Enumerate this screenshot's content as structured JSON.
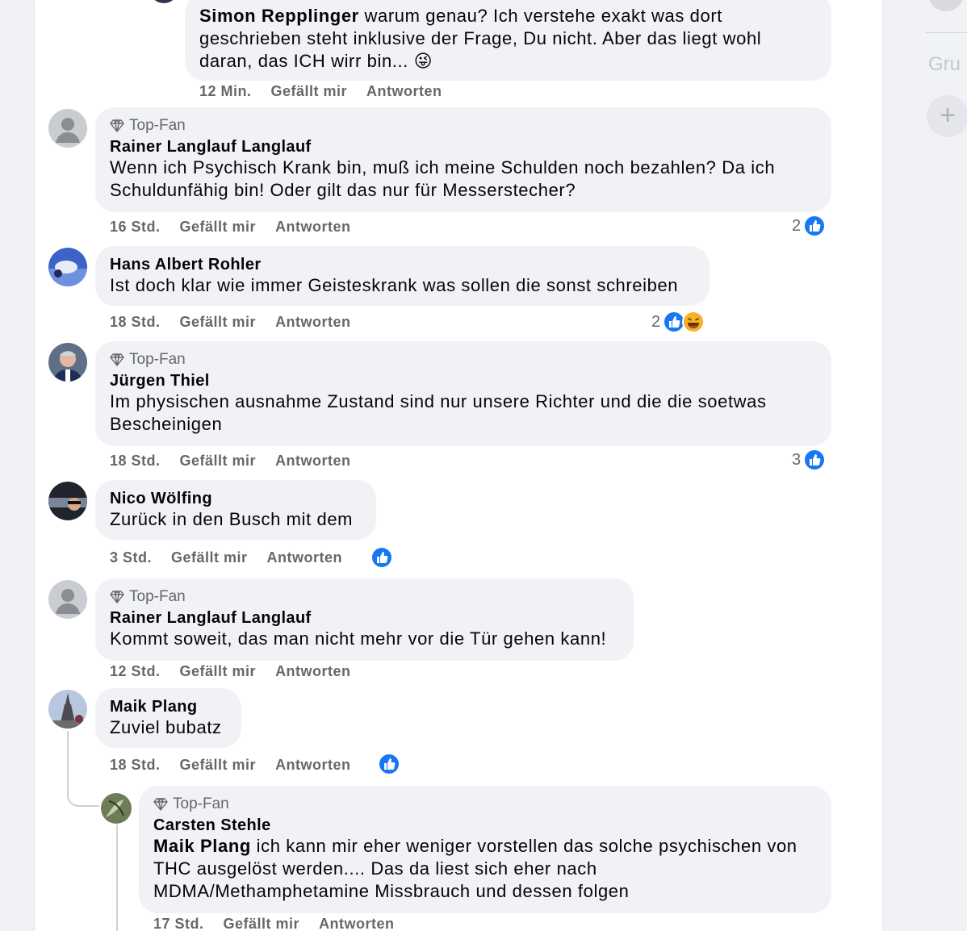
{
  "colors": {
    "like_blue": "#1877f2",
    "bubble_bg": "#f0f2f5",
    "meta_text": "#65676b"
  },
  "sidebar": {
    "group_label_fragment": "Gru",
    "add_label": "+"
  },
  "comments": [
    {
      "author": "Simon Repplinger",
      "text": " warum genau? Ich verstehe exakt was dort geschrieben steht inklusive der Frage, Du nicht. Aber das liegt wohl daran, das ICH wirr bin... 😜",
      "time": "12 Min.",
      "like_label": "Gefällt mir",
      "reply_label": "Antworten"
    },
    {
      "badge": "Top-Fan",
      "author": "Rainer Langlauf Langlauf",
      "text": "Wenn ich Psychisch Krank bin, muß ich meine Schulden noch bezahlen? Da ich Schuldunfähig bin! Oder gilt das nur für Messerstecher?",
      "time": "16 Std.",
      "like_label": "Gefällt mir",
      "reply_label": "Antworten",
      "reaction_count": "2",
      "reactions": [
        "like"
      ]
    },
    {
      "author": "Hans Albert Rohler",
      "text": "Ist doch klar wie immer Geisteskrank was sollen die sonst schreiben",
      "time": "18 Std.",
      "like_label": "Gefällt mir",
      "reply_label": "Antworten",
      "reaction_count": "2",
      "reactions": [
        "like",
        "haha"
      ]
    },
    {
      "badge": "Top-Fan",
      "author": "Jürgen Thiel",
      "text": "Im physischen ausnahme Zustand sind nur unsere Richter und die die soetwas Bescheinigen",
      "time": "18 Std.",
      "like_label": "Gefällt mir",
      "reply_label": "Antworten",
      "reaction_count": "3",
      "reactions": [
        "like"
      ]
    },
    {
      "author": "Nico Wölfing",
      "text": "Zurück in den Busch mit dem",
      "time": "3 Std.",
      "like_label": "Gefällt mir",
      "reply_label": "Antworten",
      "reactions": [
        "like"
      ]
    },
    {
      "badge": "Top-Fan",
      "author": "Rainer Langlauf Langlauf",
      "text": "Kommt soweit, das man nicht mehr vor die Tür gehen kann!",
      "time": "12 Std.",
      "like_label": "Gefällt mir",
      "reply_label": "Antworten"
    },
    {
      "author": "Maik Plang",
      "text": "Zuviel bubatz",
      "time": "18 Std.",
      "like_label": "Gefällt mir",
      "reply_label": "Antworten",
      "reactions": [
        "like"
      ]
    },
    {
      "badge": "Top-Fan",
      "author": "Carsten Stehle",
      "mention": "Maik Plang",
      "text": " ich kann mir eher weniger vorstellen das solche psychischen von THC ausgelöst werden.... Das da liest sich eher nach MDMA/Methamphetamine Missbrauch und dessen folgen",
      "time": "17 Std.",
      "like_label": "Gefällt mir",
      "reply_label": "Antworten"
    }
  ]
}
